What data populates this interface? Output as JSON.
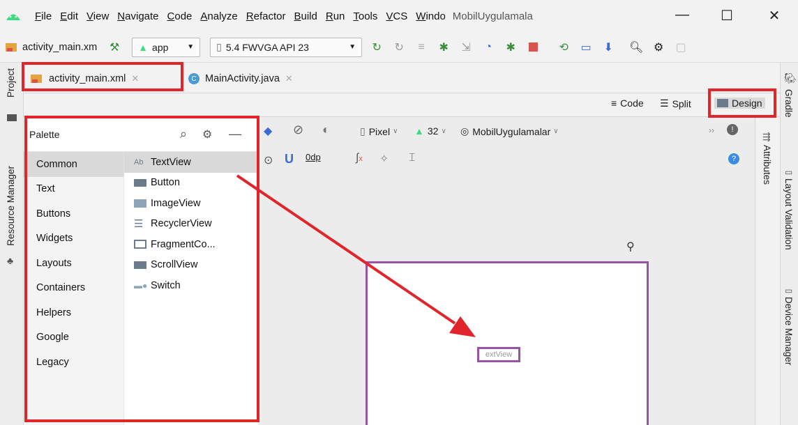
{
  "menubar": {
    "items": [
      "File",
      "Edit",
      "View",
      "Navigate",
      "Code",
      "Analyze",
      "Refactor",
      "Build",
      "Run",
      "Tools",
      "VCS",
      "Windo"
    ],
    "project_title": "MobilUygulamala",
    "minimize": "—",
    "maximize": "☐",
    "close": "✕"
  },
  "toolbar": {
    "file_name": "activity_main.xm",
    "module": "app",
    "device": "5.4  FWVGA API 23"
  },
  "left_strip": {
    "project": "Project",
    "resource_manager": "Resource Manager"
  },
  "right_strip": {
    "gradle": "Gradle",
    "layout_validation": "Layout Validation",
    "device_manager": "Device Manager"
  },
  "tabs": [
    {
      "label": "activity_main.xml",
      "close": "✕"
    },
    {
      "label": "MainActivity.java",
      "close": "✕"
    }
  ],
  "view_modes": {
    "code": "Code",
    "split": "Split",
    "design": "Design"
  },
  "palette": {
    "title": "Palette",
    "categories": [
      "Common",
      "Text",
      "Buttons",
      "Widgets",
      "Layouts",
      "Containers",
      "Helpers",
      "Google",
      "Legacy"
    ],
    "items": [
      {
        "icon": "Ab",
        "label": "TextView"
      },
      {
        "icon": "btn",
        "label": "Button"
      },
      {
        "icon": "img",
        "label": "ImageView"
      },
      {
        "icon": "list",
        "label": "RecyclerView"
      },
      {
        "icon": "frag",
        "label": "FragmentCo..."
      },
      {
        "icon": "scroll",
        "label": "ScrollView"
      },
      {
        "icon": "switch",
        "label": "Switch"
      }
    ]
  },
  "design_toolbar": {
    "device": "Pixel",
    "api": "32",
    "theme": "MobilUygulamalar",
    "margin": "0dp",
    "attributes": "Attributes"
  },
  "canvas": {
    "textview_label": "extView"
  },
  "colors": {
    "highlight": "#e0252b",
    "blueprint": "#9a52a6",
    "android_green": "#3ddc84",
    "selection": "#d9d9d9"
  }
}
